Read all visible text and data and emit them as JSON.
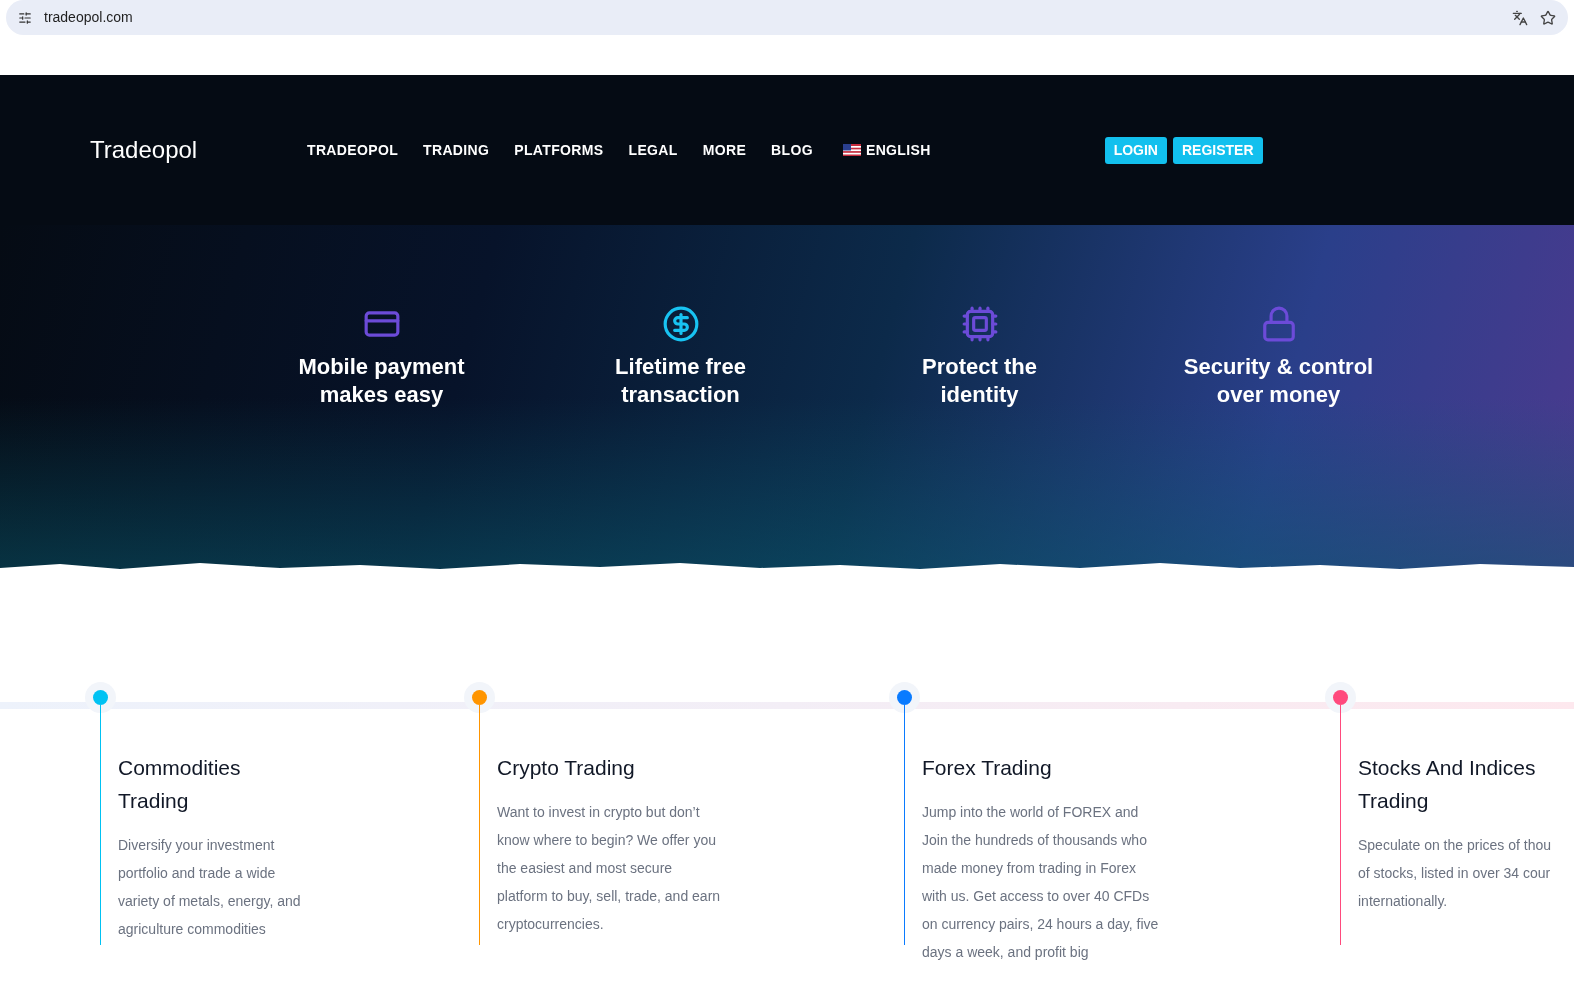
{
  "browser": {
    "url": "tradeopol.com"
  },
  "nav": {
    "logo": "Tradeopol",
    "items": [
      "TRADEOPOL",
      "TRADING",
      "PLATFORMS",
      "LEGAL",
      "MORE",
      "BLOG"
    ],
    "language": "ENGLISH",
    "buttons": [
      "LOGIN",
      "REGISTER"
    ]
  },
  "features": [
    {
      "title": "Mobile payment makes easy"
    },
    {
      "title": "Lifetime free transaction"
    },
    {
      "title": "Protect the identity"
    },
    {
      "title": "Security & control over money"
    }
  ],
  "services": [
    {
      "title": "Commodities Trading",
      "color": "#00c2f3",
      "lines": [
        "Diversify your investment",
        "portfolio and trade a wide",
        "variety of metals, energy, and",
        "agriculture commodities"
      ]
    },
    {
      "title": "Crypto Trading",
      "color": "#ff9500",
      "lines": [
        "Want to invest in crypto but don’t",
        "know where to begin? We offer you",
        "the easiest and most secure",
        "platform to buy, sell, trade, and earn",
        "cryptocurrencies."
      ]
    },
    {
      "title": "Forex Trading",
      "color": "#0a7bff",
      "lines": [
        "Jump into the world of FOREX and",
        "Join the hundreds of thousands who",
        "made money from trading in Forex",
        "with us. Get access to over 40 CFDs",
        "on currency pairs, 24 hours a day, five",
        "days a week, and profit big"
      ]
    },
    {
      "title": "Stocks And Indices Trading",
      "color": "#ff4a7d",
      "lines": [
        "Speculate on the prices of thou",
        "of stocks, listed in over 34 cour",
        "internationally."
      ]
    }
  ]
}
